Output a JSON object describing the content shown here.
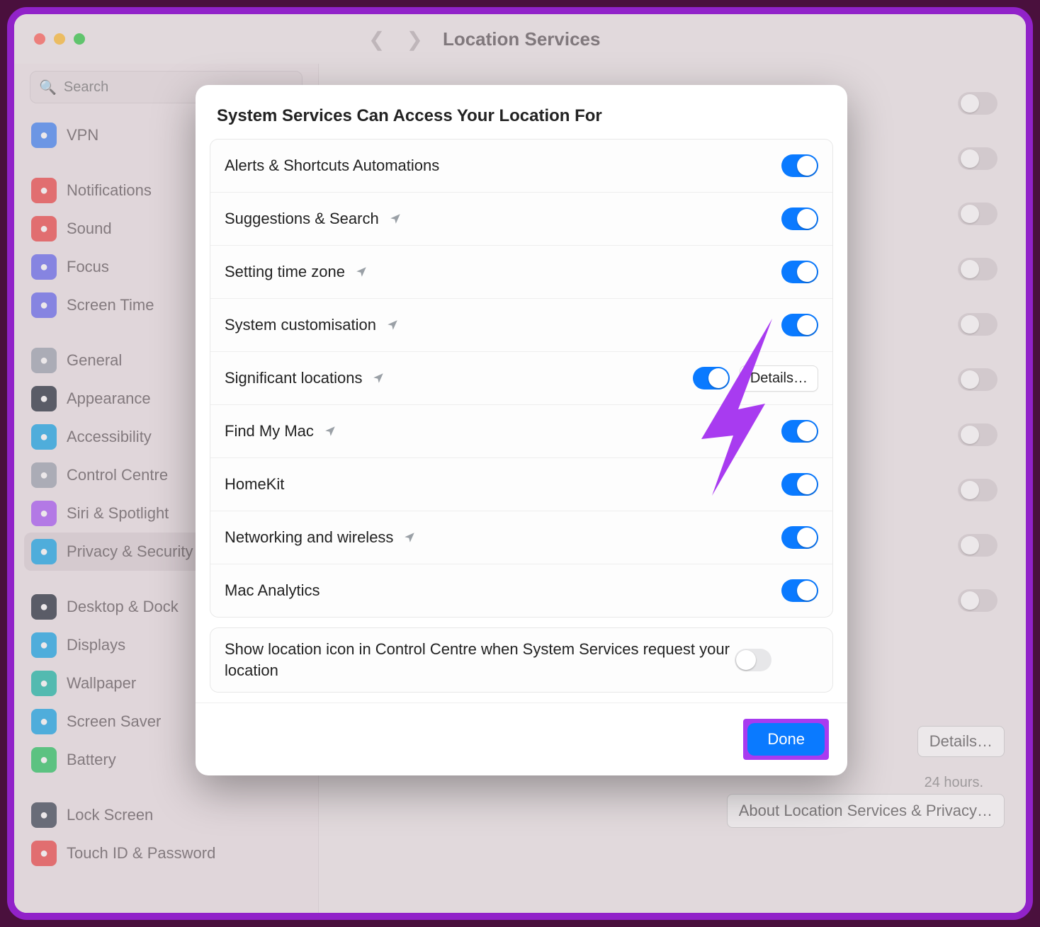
{
  "header": {
    "title": "Location Services"
  },
  "search": {
    "placeholder": "Search"
  },
  "sidebar": {
    "items": [
      {
        "label": "VPN",
        "icon_name": "vpn-icon",
        "color": "ic-blue",
        "gap_after": true,
        "truncated": true
      },
      {
        "label": "Notifications",
        "icon_name": "bell-icon",
        "color": "ic-red"
      },
      {
        "label": "Sound",
        "icon_name": "speaker-icon",
        "color": "ic-red"
      },
      {
        "label": "Focus",
        "icon_name": "moon-icon",
        "color": "ic-indigo"
      },
      {
        "label": "Screen Time",
        "icon_name": "hourglass-icon",
        "color": "ic-indigo",
        "gap_after": true
      },
      {
        "label": "General",
        "icon_name": "gear-icon",
        "color": "ic-grey"
      },
      {
        "label": "Appearance",
        "icon_name": "appearance-icon",
        "color": "ic-black"
      },
      {
        "label": "Accessibility",
        "icon_name": "accessibility-icon",
        "color": "ic-cyan"
      },
      {
        "label": "Control Centre",
        "icon_name": "control-centre-icon",
        "color": "ic-grey"
      },
      {
        "label": "Siri & Spotlight",
        "icon_name": "siri-icon",
        "color": "ic-pink"
      },
      {
        "label": "Privacy & Security",
        "icon_name": "hand-icon",
        "color": "ic-cyan",
        "selected": true,
        "gap_after": true
      },
      {
        "label": "Desktop & Dock",
        "icon_name": "desktop-icon",
        "color": "ic-black"
      },
      {
        "label": "Displays",
        "icon_name": "displays-icon",
        "color": "ic-cyan"
      },
      {
        "label": "Wallpaper",
        "icon_name": "wallpaper-icon",
        "color": "ic-teal"
      },
      {
        "label": "Screen Saver",
        "icon_name": "screensaver-icon",
        "color": "ic-cyan"
      },
      {
        "label": "Battery",
        "icon_name": "battery-icon",
        "color": "ic-green",
        "gap_after": true
      },
      {
        "label": "Lock Screen",
        "icon_name": "lock-icon",
        "color": "ic-dark"
      },
      {
        "label": "Touch ID & Password",
        "icon_name": "fingerprint-icon",
        "color": "ic-red"
      }
    ]
  },
  "background": {
    "details_label": "Details…",
    "about_label": "About Location Services & Privacy…",
    "hours_text": "24 hours."
  },
  "modal": {
    "title": "System Services Can Access Your Location For",
    "rows": [
      {
        "name": "alerts-shortcuts",
        "label": "Alerts & Shortcuts Automations",
        "arrow": false,
        "on": true
      },
      {
        "name": "suggestions-search",
        "label": "Suggestions & Search",
        "arrow": true,
        "on": true
      },
      {
        "name": "setting-time-zone",
        "label": "Setting time zone",
        "arrow": true,
        "on": true
      },
      {
        "name": "system-customisation",
        "label": "System customisation",
        "arrow": true,
        "on": true
      },
      {
        "name": "significant-locations",
        "label": "Significant locations",
        "arrow": true,
        "on": true,
        "details": true
      },
      {
        "name": "find-my-mac",
        "label": "Find My Mac",
        "arrow": true,
        "on": true
      },
      {
        "name": "homekit",
        "label": "HomeKit",
        "arrow": false,
        "on": true
      },
      {
        "name": "networking-wireless",
        "label": "Networking and wireless",
        "arrow": true,
        "on": true
      },
      {
        "name": "mac-analytics",
        "label": "Mac Analytics",
        "arrow": false,
        "on": true
      }
    ],
    "show_icon_row": {
      "label": "Show location icon in Control Centre when System Services request your location",
      "on": false
    },
    "details_label": "Details…",
    "done_label": "Done"
  }
}
